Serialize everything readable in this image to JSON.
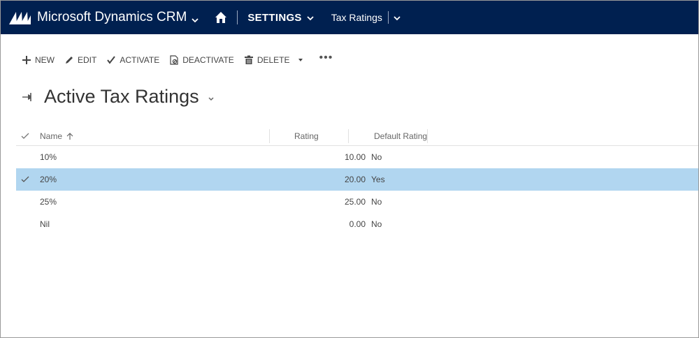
{
  "nav": {
    "app_name": "Microsoft Dynamics CRM",
    "area": "SETTINGS",
    "entity": "Tax Ratings",
    "brand_color": "#002050"
  },
  "commands": {
    "new": "NEW",
    "edit": "EDIT",
    "activate": "ACTIVATE",
    "deactivate": "DEACTIVATE",
    "delete": "DELETE",
    "more": "•••"
  },
  "view": {
    "title": "Active Tax Ratings"
  },
  "grid": {
    "columns": {
      "name": "Name",
      "rating": "Rating",
      "default_rating": "Default Rating"
    },
    "rows": [
      {
        "name": "10%",
        "rating": "10.00",
        "default_rating": "No",
        "selected": false
      },
      {
        "name": "20%",
        "rating": "20.00",
        "default_rating": "Yes",
        "selected": true
      },
      {
        "name": "25%",
        "rating": "25.00",
        "default_rating": "No",
        "selected": false
      },
      {
        "name": "Nil",
        "rating": "0.00",
        "default_rating": "No",
        "selected": false
      }
    ],
    "selected_color": "#b1d6f0"
  }
}
